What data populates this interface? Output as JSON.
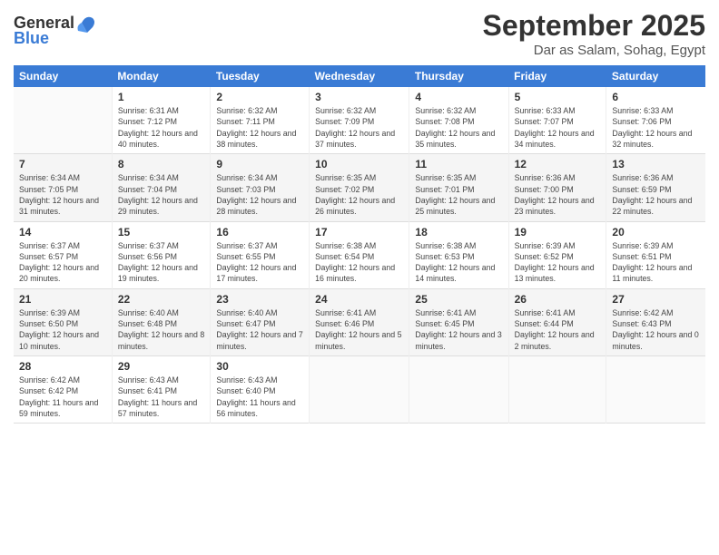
{
  "header": {
    "logo": {
      "general": "General",
      "blue": "Blue"
    },
    "title": "September 2025",
    "location": "Dar as Salam, Sohag, Egypt"
  },
  "days_of_week": [
    "Sunday",
    "Monday",
    "Tuesday",
    "Wednesday",
    "Thursday",
    "Friday",
    "Saturday"
  ],
  "weeks": [
    [
      {
        "day": "",
        "sunrise": "",
        "sunset": "",
        "daylight": ""
      },
      {
        "day": "1",
        "sunrise": "Sunrise: 6:31 AM",
        "sunset": "Sunset: 7:12 PM",
        "daylight": "Daylight: 12 hours and 40 minutes."
      },
      {
        "day": "2",
        "sunrise": "Sunrise: 6:32 AM",
        "sunset": "Sunset: 7:11 PM",
        "daylight": "Daylight: 12 hours and 38 minutes."
      },
      {
        "day": "3",
        "sunrise": "Sunrise: 6:32 AM",
        "sunset": "Sunset: 7:09 PM",
        "daylight": "Daylight: 12 hours and 37 minutes."
      },
      {
        "day": "4",
        "sunrise": "Sunrise: 6:32 AM",
        "sunset": "Sunset: 7:08 PM",
        "daylight": "Daylight: 12 hours and 35 minutes."
      },
      {
        "day": "5",
        "sunrise": "Sunrise: 6:33 AM",
        "sunset": "Sunset: 7:07 PM",
        "daylight": "Daylight: 12 hours and 34 minutes."
      },
      {
        "day": "6",
        "sunrise": "Sunrise: 6:33 AM",
        "sunset": "Sunset: 7:06 PM",
        "daylight": "Daylight: 12 hours and 32 minutes."
      }
    ],
    [
      {
        "day": "7",
        "sunrise": "Sunrise: 6:34 AM",
        "sunset": "Sunset: 7:05 PM",
        "daylight": "Daylight: 12 hours and 31 minutes."
      },
      {
        "day": "8",
        "sunrise": "Sunrise: 6:34 AM",
        "sunset": "Sunset: 7:04 PM",
        "daylight": "Daylight: 12 hours and 29 minutes."
      },
      {
        "day": "9",
        "sunrise": "Sunrise: 6:34 AM",
        "sunset": "Sunset: 7:03 PM",
        "daylight": "Daylight: 12 hours and 28 minutes."
      },
      {
        "day": "10",
        "sunrise": "Sunrise: 6:35 AM",
        "sunset": "Sunset: 7:02 PM",
        "daylight": "Daylight: 12 hours and 26 minutes."
      },
      {
        "day": "11",
        "sunrise": "Sunrise: 6:35 AM",
        "sunset": "Sunset: 7:01 PM",
        "daylight": "Daylight: 12 hours and 25 minutes."
      },
      {
        "day": "12",
        "sunrise": "Sunrise: 6:36 AM",
        "sunset": "Sunset: 7:00 PM",
        "daylight": "Daylight: 12 hours and 23 minutes."
      },
      {
        "day": "13",
        "sunrise": "Sunrise: 6:36 AM",
        "sunset": "Sunset: 6:59 PM",
        "daylight": "Daylight: 12 hours and 22 minutes."
      }
    ],
    [
      {
        "day": "14",
        "sunrise": "Sunrise: 6:37 AM",
        "sunset": "Sunset: 6:57 PM",
        "daylight": "Daylight: 12 hours and 20 minutes."
      },
      {
        "day": "15",
        "sunrise": "Sunrise: 6:37 AM",
        "sunset": "Sunset: 6:56 PM",
        "daylight": "Daylight: 12 hours and 19 minutes."
      },
      {
        "day": "16",
        "sunrise": "Sunrise: 6:37 AM",
        "sunset": "Sunset: 6:55 PM",
        "daylight": "Daylight: 12 hours and 17 minutes."
      },
      {
        "day": "17",
        "sunrise": "Sunrise: 6:38 AM",
        "sunset": "Sunset: 6:54 PM",
        "daylight": "Daylight: 12 hours and 16 minutes."
      },
      {
        "day": "18",
        "sunrise": "Sunrise: 6:38 AM",
        "sunset": "Sunset: 6:53 PM",
        "daylight": "Daylight: 12 hours and 14 minutes."
      },
      {
        "day": "19",
        "sunrise": "Sunrise: 6:39 AM",
        "sunset": "Sunset: 6:52 PM",
        "daylight": "Daylight: 12 hours and 13 minutes."
      },
      {
        "day": "20",
        "sunrise": "Sunrise: 6:39 AM",
        "sunset": "Sunset: 6:51 PM",
        "daylight": "Daylight: 12 hours and 11 minutes."
      }
    ],
    [
      {
        "day": "21",
        "sunrise": "Sunrise: 6:39 AM",
        "sunset": "Sunset: 6:50 PM",
        "daylight": "Daylight: 12 hours and 10 minutes."
      },
      {
        "day": "22",
        "sunrise": "Sunrise: 6:40 AM",
        "sunset": "Sunset: 6:48 PM",
        "daylight": "Daylight: 12 hours and 8 minutes."
      },
      {
        "day": "23",
        "sunrise": "Sunrise: 6:40 AM",
        "sunset": "Sunset: 6:47 PM",
        "daylight": "Daylight: 12 hours and 7 minutes."
      },
      {
        "day": "24",
        "sunrise": "Sunrise: 6:41 AM",
        "sunset": "Sunset: 6:46 PM",
        "daylight": "Daylight: 12 hours and 5 minutes."
      },
      {
        "day": "25",
        "sunrise": "Sunrise: 6:41 AM",
        "sunset": "Sunset: 6:45 PM",
        "daylight": "Daylight: 12 hours and 3 minutes."
      },
      {
        "day": "26",
        "sunrise": "Sunrise: 6:41 AM",
        "sunset": "Sunset: 6:44 PM",
        "daylight": "Daylight: 12 hours and 2 minutes."
      },
      {
        "day": "27",
        "sunrise": "Sunrise: 6:42 AM",
        "sunset": "Sunset: 6:43 PM",
        "daylight": "Daylight: 12 hours and 0 minutes."
      }
    ],
    [
      {
        "day": "28",
        "sunrise": "Sunrise: 6:42 AM",
        "sunset": "Sunset: 6:42 PM",
        "daylight": "Daylight: 11 hours and 59 minutes."
      },
      {
        "day": "29",
        "sunrise": "Sunrise: 6:43 AM",
        "sunset": "Sunset: 6:41 PM",
        "daylight": "Daylight: 11 hours and 57 minutes."
      },
      {
        "day": "30",
        "sunrise": "Sunrise: 6:43 AM",
        "sunset": "Sunset: 6:40 PM",
        "daylight": "Daylight: 11 hours and 56 minutes."
      },
      {
        "day": "",
        "sunrise": "",
        "sunset": "",
        "daylight": ""
      },
      {
        "day": "",
        "sunrise": "",
        "sunset": "",
        "daylight": ""
      },
      {
        "day": "",
        "sunrise": "",
        "sunset": "",
        "daylight": ""
      },
      {
        "day": "",
        "sunrise": "",
        "sunset": "",
        "daylight": ""
      }
    ]
  ]
}
